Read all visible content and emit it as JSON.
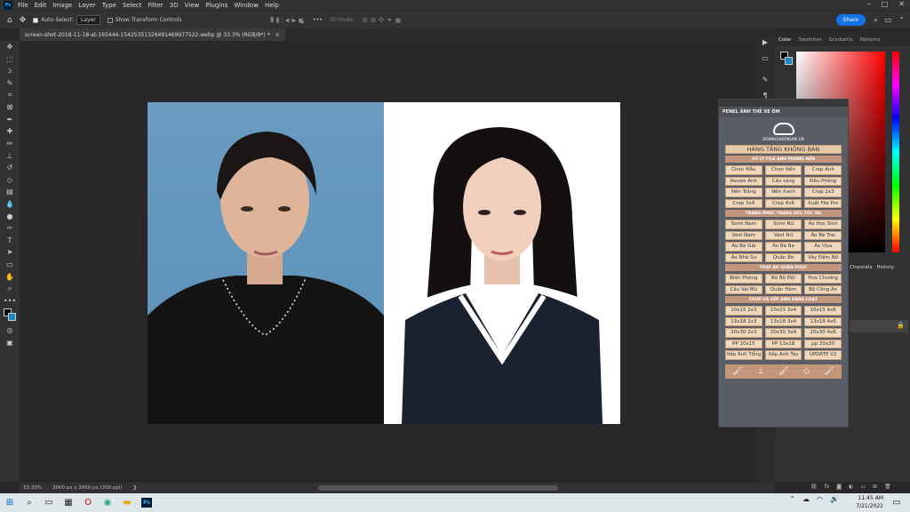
{
  "menubar": {
    "items": [
      "File",
      "Edit",
      "Image",
      "Layer",
      "Type",
      "Select",
      "Filter",
      "3D",
      "View",
      "Plugins",
      "Window",
      "Help"
    ],
    "window_controls": [
      "–",
      "□",
      "✕"
    ]
  },
  "options": {
    "auto_select_label": "Auto-Select:",
    "auto_select_value": "Layer",
    "transform_label": "Show Transform Controls",
    "mode_3d_label": "3D Mode:",
    "share_label": "Share"
  },
  "document": {
    "tab_title": "screen-shot-2018-11-18-at-165444-15425351326491469977522.webp @ 33.3% (RGB/8*) *",
    "close_glyph": "×"
  },
  "status": {
    "zoom": "33.33%",
    "doc_info": "3000 px x 2000 px (300 ppi)"
  },
  "right_panel": {
    "tabs": [
      "Color",
      "Swatches",
      "Gradients",
      "Patterns"
    ],
    "layers_tabs": [
      "Channels",
      "History"
    ]
  },
  "plugin": {
    "title": "PENEL ẢNH THẺ XE ÔM",
    "logo_text": "DOWNLOADONLINE.VN",
    "free_label": "HÀNG TẶNG KHÔNG BÁN",
    "sections": [
      {
        "title": "XỬ LÝ FILE ẢNH PHÔNG NỀN",
        "buttons": [
          "Chọn Mẫu",
          "Chọn Nền",
          "Crop Ảnh",
          "Resize Ảnh",
          "Cân sáng",
          "Đều Phông",
          "Nền Trắng",
          "Nền Xanh",
          "Crop 2x3",
          "Crop 3x4",
          "Crop 4x6",
          "Xuất File Pro"
        ]
      },
      {
        "title": "TRANG PHỤC TRANG SỨC TÓC TAI",
        "buttons": [
          "Somi Nam",
          "Somi Nữ",
          "Áo Học Sinh",
          "Vest Nam",
          "Vest Nữ",
          "Áo Bé Trai",
          "Áo Bé Gái",
          "Áo Bà Ba",
          "Áo Visa",
          "Áo Nhà Sư",
          "Quần Bò",
          "Váy Đầm Nữ"
        ]
      },
      {
        "title": "THAY ÁO QUÂN PHỤC",
        "buttons": [
          "Biên Phòng",
          "Bộ Bộ Đội",
          "Huy Chương",
          "Cầu Vai Mũ",
          "Quân Hàm",
          "Bộ Công An"
        ]
      },
      {
        "title": "CROP VÀ XẾP ẢNH HÀNG LOẠT",
        "buttons": [
          "10x15 2x3",
          "10x15 3x4",
          "10x15 4x6",
          "13x18 2x3",
          "13x18 3x4",
          "13x18 4x6",
          "20x30 2x3",
          "20x30 3x4",
          "20x30 4x6",
          "PP 10x15",
          "PP 13x18",
          "pp 20x30",
          "Xếp Ảnh Tổng",
          "Xếp Ảnh Tay",
          "UPDATE V2"
        ]
      }
    ],
    "tool_icons": [
      "brush-icon",
      "stamp-icon",
      "brush-icon",
      "eraser-icon",
      "brush-icon"
    ]
  },
  "taskbar": {
    "time": "11:45 AM",
    "date": "7/21/2022"
  }
}
